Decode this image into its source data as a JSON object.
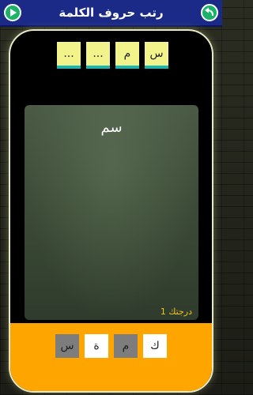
{
  "header": {
    "title": "رتب حروف الكلمة",
    "left_button_icon": "play-arrow-icon",
    "right_button_icon": "back-arrow-icon"
  },
  "answer_slots": [
    "...",
    "...",
    "م",
    "س"
  ],
  "board": {
    "word": "سم",
    "level_label": "درجتك 1"
  },
  "letter_tiles": [
    {
      "letter": "س",
      "state": "used"
    },
    {
      "letter": "ة",
      "state": "available"
    },
    {
      "letter": "م",
      "state": "used"
    },
    {
      "letter": "ك",
      "state": "available"
    }
  ],
  "colors": {
    "header_bg": "#1a2a86",
    "button_green": "#1bb36b",
    "slot_yellow": "#f3f38c",
    "slot_underline": "#17b7b3",
    "bottom_orange": "#ffa500",
    "level_text": "#f0c41c"
  }
}
